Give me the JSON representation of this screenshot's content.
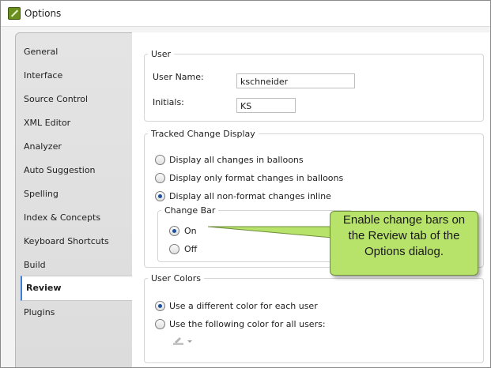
{
  "window": {
    "title": "Options"
  },
  "sidebar": {
    "items": [
      {
        "label": "General"
      },
      {
        "label": "Interface"
      },
      {
        "label": "Source Control"
      },
      {
        "label": "XML Editor"
      },
      {
        "label": "Analyzer"
      },
      {
        "label": "Auto Suggestion"
      },
      {
        "label": "Spelling"
      },
      {
        "label": "Index & Concepts"
      },
      {
        "label": "Keyboard Shortcuts"
      },
      {
        "label": "Build"
      },
      {
        "label": "Review",
        "selected": true
      },
      {
        "label": "Plugins"
      }
    ]
  },
  "user_group": {
    "legend": "User",
    "user_name_label": "User Name:",
    "user_name_value": "kschneider",
    "initials_label": "Initials:",
    "initials_value": "KS"
  },
  "tracked_change_group": {
    "legend": "Tracked Change Display",
    "options": [
      {
        "label": "Display all changes in balloons",
        "checked": false
      },
      {
        "label": "Display only format changes in balloons",
        "checked": false
      },
      {
        "label": "Display all non-format changes inline",
        "checked": true
      }
    ],
    "change_bar": {
      "legend": "Change Bar",
      "options": [
        {
          "label": "On",
          "checked": true
        },
        {
          "label": "Off",
          "checked": false
        }
      ]
    }
  },
  "user_colors_group": {
    "legend": "User Colors",
    "options": [
      {
        "label": "Use a different color for each user",
        "checked": true
      },
      {
        "label": "Use the following color for all users:",
        "checked": false
      }
    ]
  },
  "callout": {
    "text": "Enable change bars on\nthe Review tab of the\nOptions dialog.",
    "color": "#b8e36a"
  },
  "colors": {
    "accent": "#3a7ed6",
    "radio_dot": "#1f4e9a"
  }
}
